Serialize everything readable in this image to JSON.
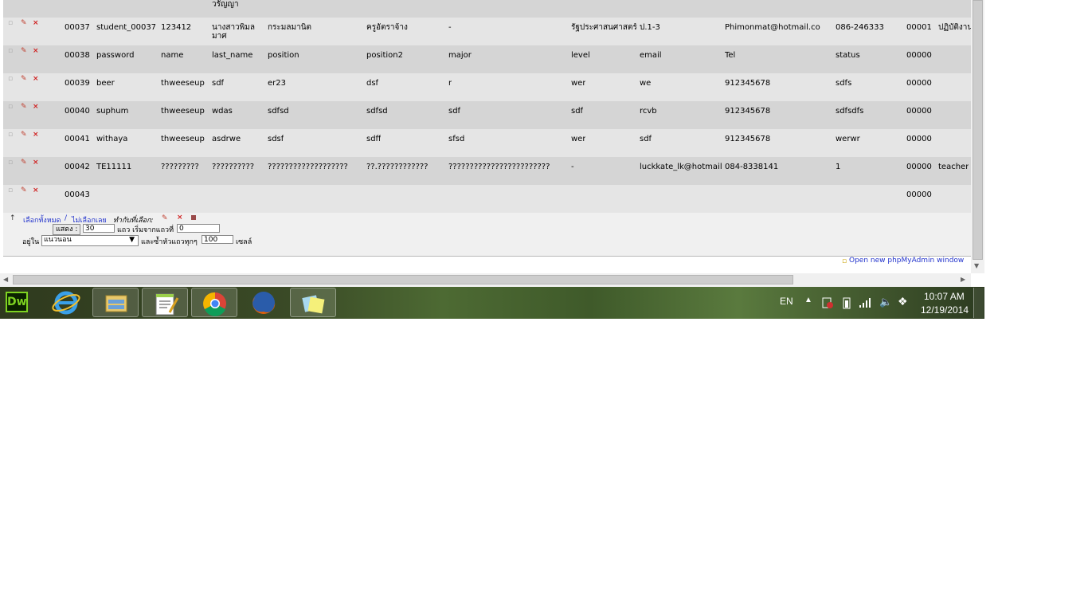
{
  "top_partial_row": {
    "name_cont": "วรัญญา"
  },
  "rows": [
    {
      "id": "00037",
      "user": "student_00037",
      "password": "123412",
      "name": "นางสาวพิมล",
      "name2": "มาศ",
      "last_name": "กระมลมานิต",
      "position": "ครูอัตราจ้าง",
      "position2": "-",
      "major": "",
      "level": "รัฐประศาสนศาสตร์",
      "email": "ป.1-3",
      "tel": "Phimonmat@hotmail.co",
      "status": "086-246333",
      "c1": "00001",
      "c2": "ปฏิบัติงาน"
    },
    {
      "id": "00038",
      "user": "password",
      "password": "name",
      "name": "last_name",
      "name2": "",
      "last_name": "position",
      "position": "position2",
      "position2": "major",
      "major": "",
      "level": "level",
      "email": "email",
      "tel": "Tel",
      "status": "status",
      "c1": "00000",
      "c2": ""
    },
    {
      "id": "00039",
      "user": "beer",
      "password": "thweeseup",
      "name": "sdf",
      "name2": "",
      "last_name": "er23",
      "position": "dsf",
      "position2": "r",
      "major": "",
      "level": "wer",
      "email": "we",
      "tel": "912345678",
      "status": "sdfs",
      "c1": "00000",
      "c2": ""
    },
    {
      "id": "00040",
      "user": "suphum",
      "password": "thweeseup",
      "name": "wdas",
      "name2": "",
      "last_name": "sdfsd",
      "position": "sdfsd",
      "position2": "sdf",
      "major": "",
      "level": "sdf",
      "email": "rcvb",
      "tel": "912345678",
      "status": "sdfsdfs",
      "c1": "00000",
      "c2": ""
    },
    {
      "id": "00041",
      "user": "withaya",
      "password": "thweeseup",
      "name": "asdrwe",
      "name2": "",
      "last_name": "sdsf",
      "position": "sdff",
      "position2": "sfsd",
      "major": "",
      "level": "wer",
      "email": "sdf",
      "tel": "912345678",
      "status": "werwr",
      "c1": "00000",
      "c2": ""
    },
    {
      "id": "00042",
      "user": "TE11111",
      "password": "?????????",
      "name": "??????????",
      "name2": "",
      "last_name": "???????????????????",
      "position": "??.????????????",
      "position2": "????????????????????????",
      "major": "",
      "level": "-",
      "email": "luckkate_lk@hotmail.",
      "tel": "084-8338141",
      "status": "1",
      "c1": "00000",
      "c2": "teacher"
    },
    {
      "id": "00043",
      "user": "",
      "password": "",
      "name": "",
      "name2": "",
      "last_name": "",
      "position": "",
      "position2": "",
      "major": "",
      "level": "",
      "email": "",
      "tel": "",
      "status": "",
      "c1": "00000",
      "c2": ""
    }
  ],
  "row_controls": {
    "checkbox": "▫",
    "edit": "✎",
    "delete": "×"
  },
  "footer": {
    "arrow": "↑",
    "select_all": "เลือกทั้งหมด",
    "separator": " / ",
    "deselect_all": "ไม่เลือกเลย",
    "with_selected": "ทำกับที่เลือก:",
    "show_button": "แสดง :",
    "rows_value": "30",
    "rows_label": "แถว เริ่มจากแถวที่",
    "start_value": "0",
    "in_label": "อยู่ใน",
    "mode_value": "แนวนอน",
    "repeat_label": "และซ้ำหัวแถวทุกๆ",
    "repeat_value": "100",
    "cells_label": "เซลล์",
    "open_window": "Open new phpMyAdmin window"
  },
  "taskbar": {
    "apps": [
      "Dreamweaver",
      "Internet Explorer",
      "Windows Explorer",
      "Notepad++",
      "Google Chrome",
      "Mozilla Firefox",
      "Sticky Notes"
    ],
    "dw_label": "Dw",
    "lang": "EN",
    "time": "10:07 AM",
    "date": "12/19/2014"
  },
  "colors": {
    "row_light": "#e5e5e5",
    "row_dark": "#d5d5d5",
    "link": "#2233cc"
  }
}
